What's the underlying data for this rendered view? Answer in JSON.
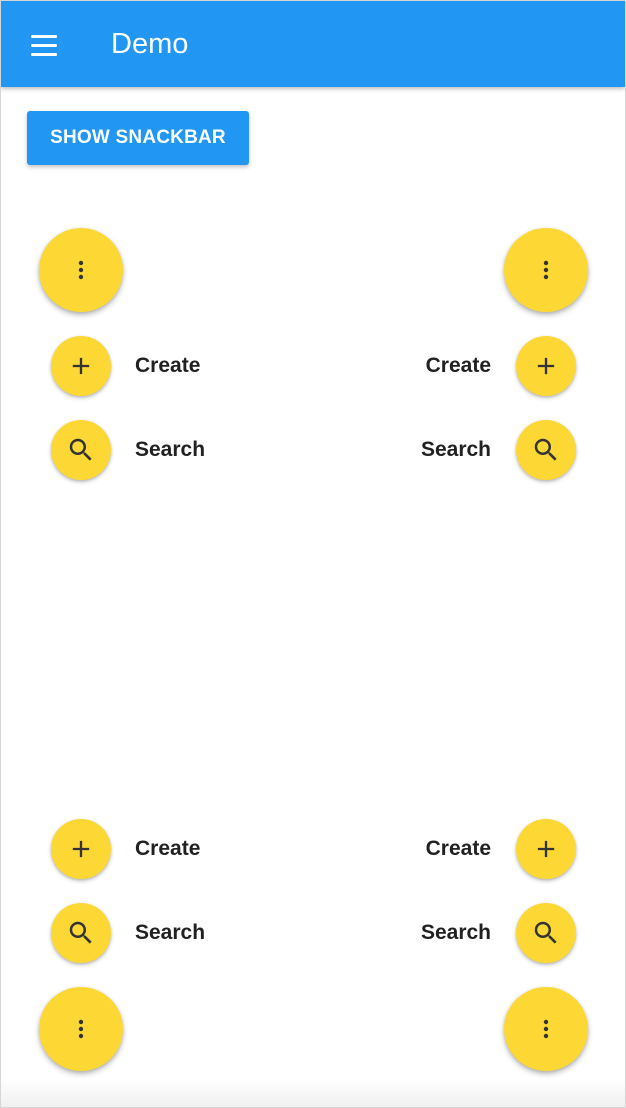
{
  "app": {
    "title": "Demo",
    "primary_color": "#2196f3",
    "fab_color": "#fdd835",
    "menu_icon": "menu-icon"
  },
  "main": {
    "snackbar_button_label": "SHOW SNACKBAR"
  },
  "speed_dials": {
    "top_left": {
      "trigger_icon": "more-vert-icon",
      "actions": [
        {
          "label": "Create",
          "icon": "add-icon"
        },
        {
          "label": "Search",
          "icon": "search-icon"
        }
      ]
    },
    "top_right": {
      "trigger_icon": "more-vert-icon",
      "actions": [
        {
          "label": "Create",
          "icon": "add-icon"
        },
        {
          "label": "Search",
          "icon": "search-icon"
        }
      ]
    },
    "bottom_left": {
      "trigger_icon": "more-vert-icon",
      "actions": [
        {
          "label": "Create",
          "icon": "add-icon"
        },
        {
          "label": "Search",
          "icon": "search-icon"
        }
      ]
    },
    "bottom_right": {
      "trigger_icon": "more-vert-icon",
      "actions": [
        {
          "label": "Create",
          "icon": "add-icon"
        },
        {
          "label": "Search",
          "icon": "search-icon"
        }
      ]
    }
  }
}
